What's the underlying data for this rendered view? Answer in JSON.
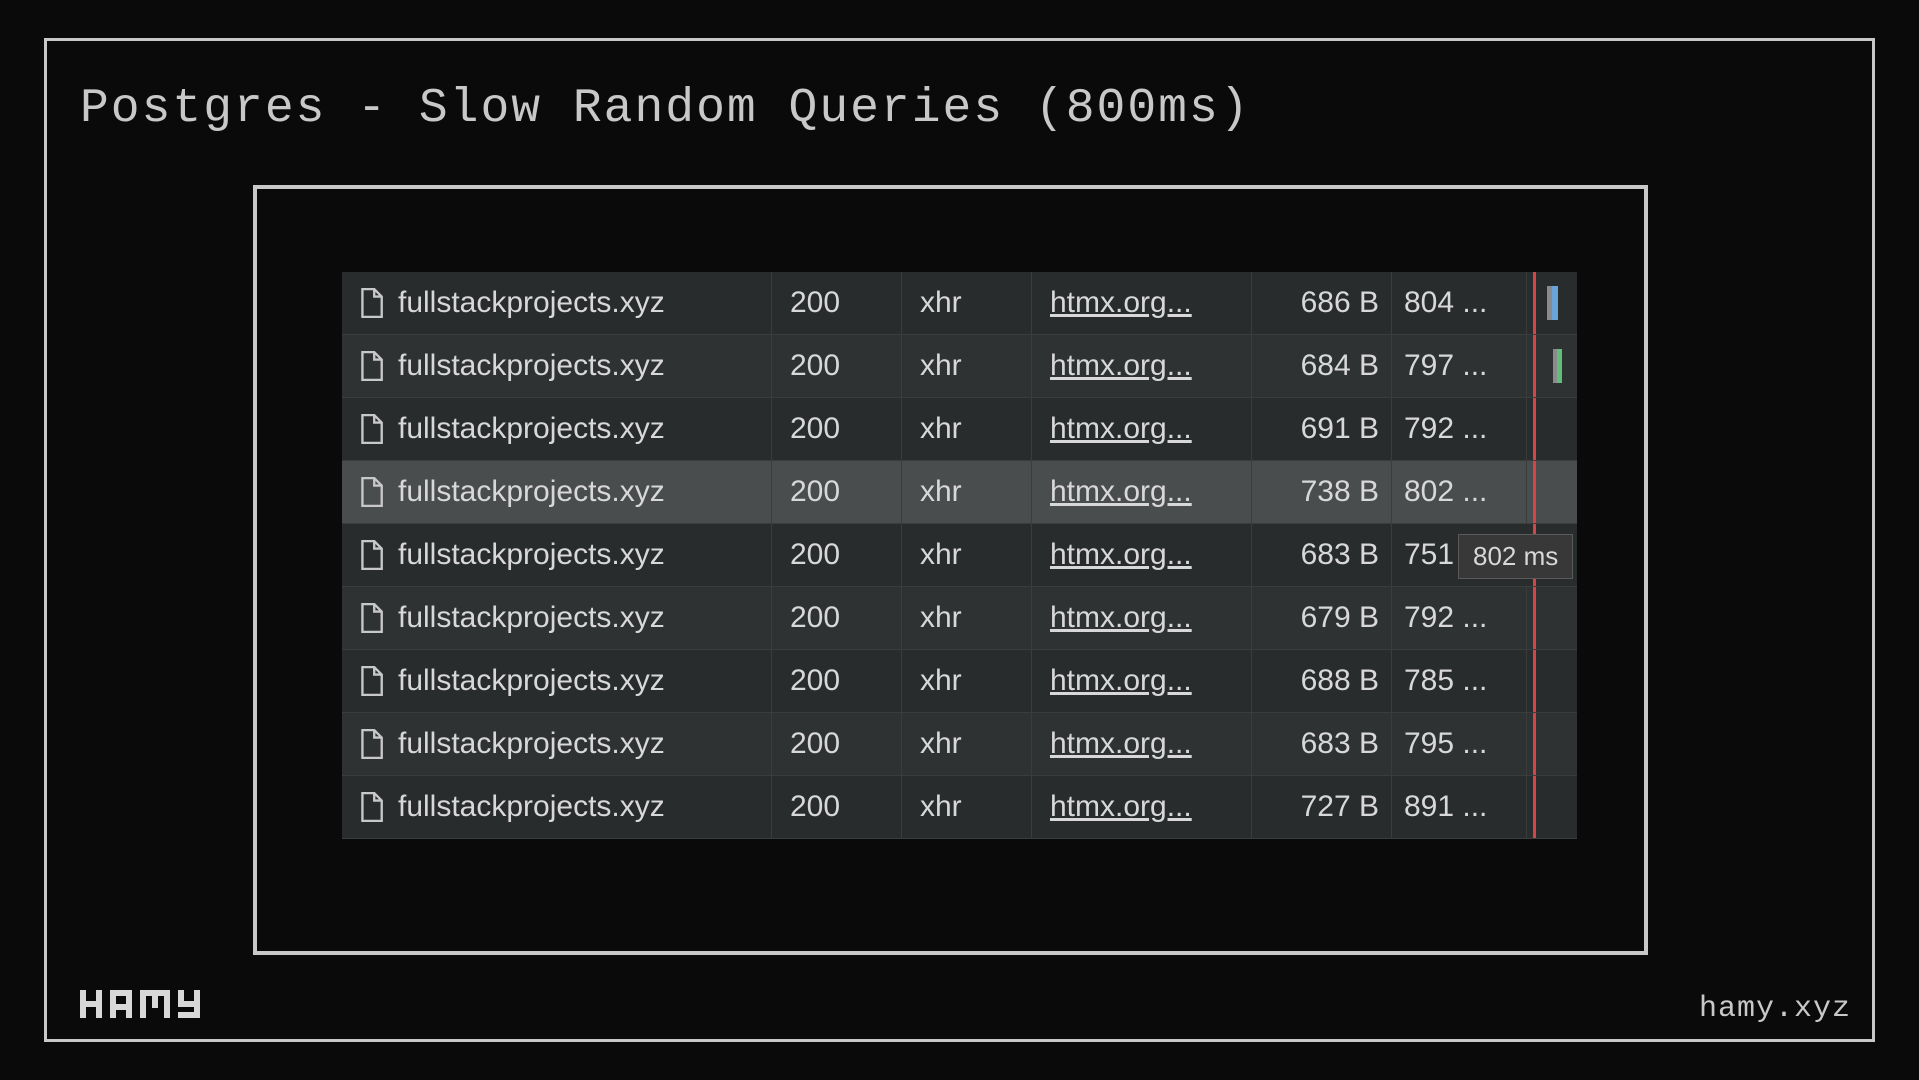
{
  "title": "Postgres - Slow Random Queries (800ms)",
  "logo": "HAMY",
  "site": "hamy.xyz",
  "tooltip": "802 ms",
  "network": {
    "rows": [
      {
        "name": "fullstackprojects.xyz",
        "status": "200",
        "type": "xhr",
        "initiator": "htmx.org...",
        "size": "686 B",
        "time": "804 ..."
      },
      {
        "name": "fullstackprojects.xyz",
        "status": "200",
        "type": "xhr",
        "initiator": "htmx.org...",
        "size": "684 B",
        "time": "797 ..."
      },
      {
        "name": "fullstackprojects.xyz",
        "status": "200",
        "type": "xhr",
        "initiator": "htmx.org...",
        "size": "691 B",
        "time": "792 ..."
      },
      {
        "name": "fullstackprojects.xyz",
        "status": "200",
        "type": "xhr",
        "initiator": "htmx.org...",
        "size": "738 B",
        "time": "802 ..."
      },
      {
        "name": "fullstackprojects.xyz",
        "status": "200",
        "type": "xhr",
        "initiator": "htmx.org...",
        "size": "683 B",
        "time": "751"
      },
      {
        "name": "fullstackprojects.xyz",
        "status": "200",
        "type": "xhr",
        "initiator": "htmx.org...",
        "size": "679 B",
        "time": "792 ..."
      },
      {
        "name": "fullstackprojects.xyz",
        "status": "200",
        "type": "xhr",
        "initiator": "htmx.org...",
        "size": "688 B",
        "time": "785 ..."
      },
      {
        "name": "fullstackprojects.xyz",
        "status": "200",
        "type": "xhr",
        "initiator": "htmx.org...",
        "size": "683 B",
        "time": "795 ..."
      },
      {
        "name": "fullstackprojects.xyz",
        "status": "200",
        "type": "xhr",
        "initiator": "htmx.org...",
        "size": "727 B",
        "time": "891 ..."
      }
    ]
  }
}
